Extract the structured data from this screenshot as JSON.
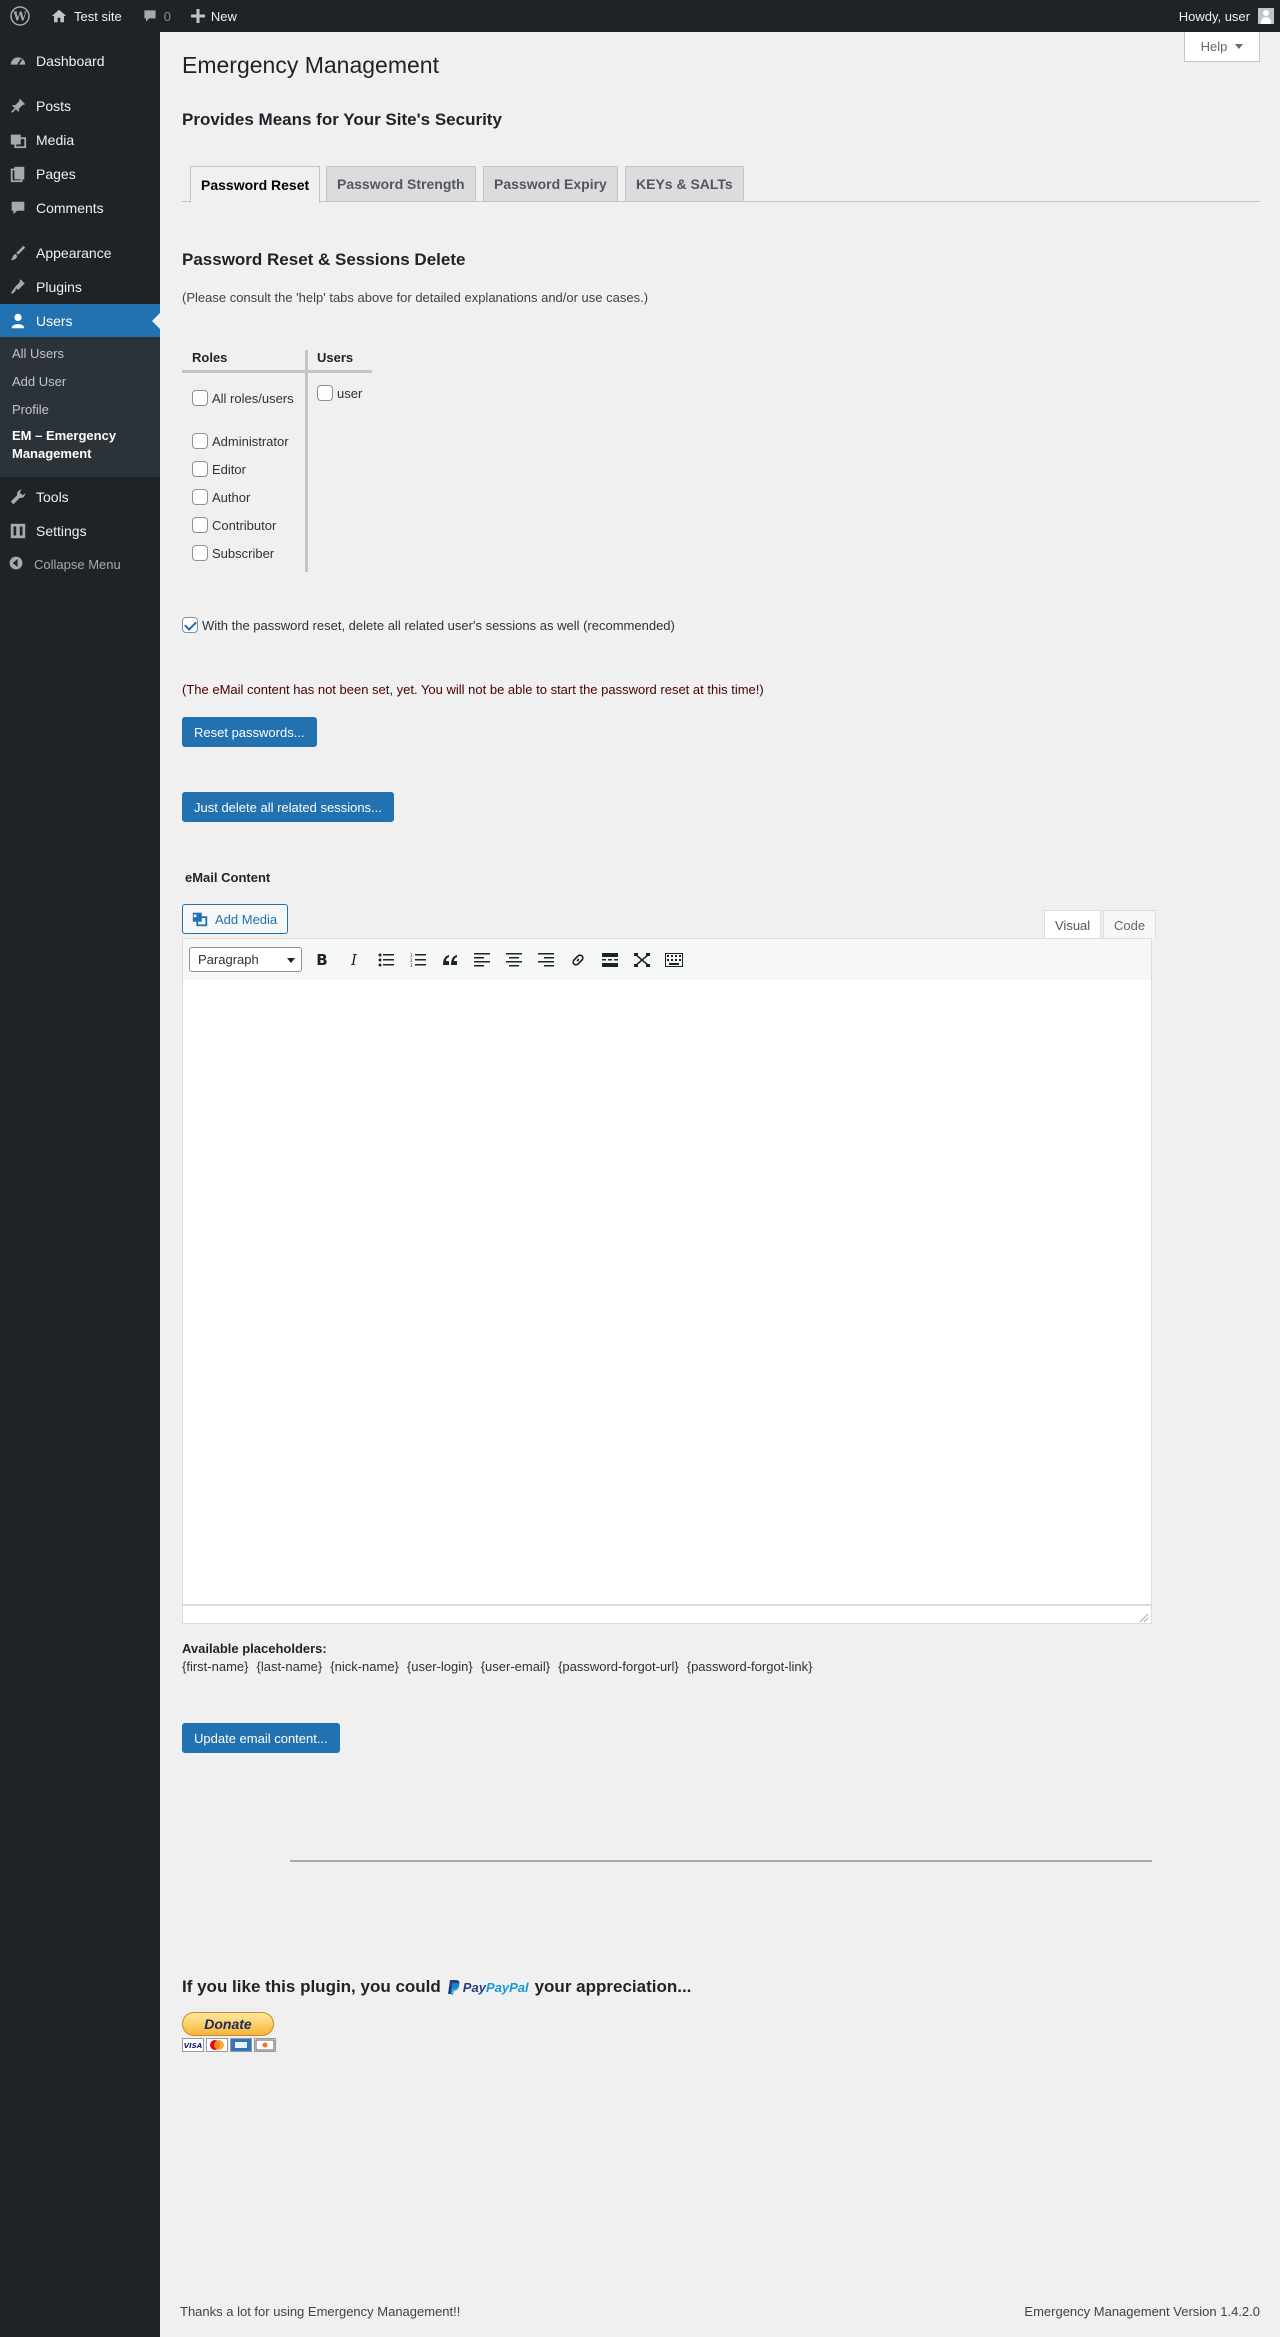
{
  "admin_bar": {
    "site_name": "Test site",
    "comments_count": "0",
    "new_label": "New",
    "greeting": "Howdy, user"
  },
  "sidebar": {
    "items": [
      {
        "label": "Dashboard",
        "icon": "dashboard-icon"
      },
      {
        "label": "Posts",
        "icon": "pin-icon"
      },
      {
        "label": "Media",
        "icon": "media-icon"
      },
      {
        "label": "Pages",
        "icon": "pages-icon"
      },
      {
        "label": "Comments",
        "icon": "comment-icon"
      },
      {
        "label": "Appearance",
        "icon": "brush-icon"
      },
      {
        "label": "Plugins",
        "icon": "plug-icon"
      },
      {
        "label": "Users",
        "icon": "user-icon"
      },
      {
        "label": "Tools",
        "icon": "wrench-icon"
      },
      {
        "label": "Settings",
        "icon": "settings-icon"
      }
    ],
    "submenu": [
      "All Users",
      "Add User",
      "Profile",
      "EM – Emergency Management"
    ],
    "collapse_label": "Collapse Menu"
  },
  "page": {
    "help_label": "Help",
    "title": "Emergency Management",
    "subtitle": "Provides Means for Your Site's Security",
    "tabs": [
      "Password Reset",
      "Password Strength",
      "Password Expiry",
      "KEYs & SALTs"
    ],
    "section_title": "Password Reset & Sessions Delete",
    "note": "(Please consult the 'help' tabs above for detailed explanations and/or use cases.)"
  },
  "roles": {
    "roles_header": "Roles",
    "users_header": "Users",
    "all_label": "All roles/users",
    "role_list": [
      "Administrator",
      "Editor",
      "Author",
      "Contributor",
      "Subscriber"
    ],
    "user_list": [
      "user"
    ]
  },
  "sessions_option": "With the password reset, delete all related user's sessions as well (recommended)",
  "warning": "(The eMail content has not been set, yet. You will not be able to start the password reset at this time!)",
  "buttons": {
    "reset": "Reset passwords...",
    "delete_sessions": "Just delete all related sessions...",
    "update_email": "Update email content..."
  },
  "email": {
    "label": "eMail Content",
    "add_media": "Add Media",
    "visual_tab": "Visual",
    "code_tab": "Code",
    "format_value": "Paragraph",
    "placeholders_title": "Available placeholders:",
    "placeholders": [
      "{first-name}",
      "{last-name}",
      "{nick-name}",
      "{user-login}",
      "{user-email}",
      "{password-forgot-url}",
      "{password-forgot-link}"
    ]
  },
  "donation": {
    "text_before": "If you like this plugin, you could",
    "paypal": "PayPal",
    "text_after": "your appreciation...",
    "donate_label": "Donate"
  },
  "footer": {
    "left": "Thanks a lot for using Emergency Management!!",
    "right": "Emergency Management Version 1.4.2.0"
  },
  "colors": {
    "accent": "#2271b1",
    "admin_bg": "#1d2327",
    "page_bg": "#f0f0f1",
    "warning_text": "#4a0000"
  }
}
